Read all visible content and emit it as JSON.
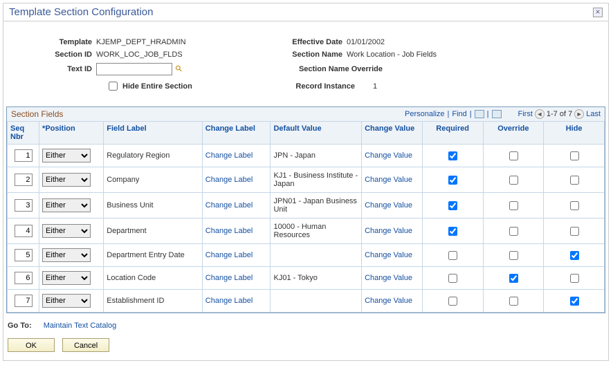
{
  "dialog": {
    "title": "Template Section Configuration"
  },
  "header": {
    "template_label": "Template",
    "template_value": "KJEMP_DEPT_HRADMIN",
    "eff_date_label": "Effective Date",
    "eff_date_value": "01/01/2002",
    "section_id_label": "Section ID",
    "section_id_value": "WORK_LOC_JOB_FLDS",
    "section_name_label": "Section Name",
    "section_name_value": "Work Location - Job Fields",
    "text_id_label": "Text ID",
    "text_id_value": "",
    "section_name_override_label": "Section Name Override",
    "section_name_override_value": "",
    "hide_section_label": "Hide Entire Section",
    "hide_section_checked": false,
    "record_instance_label": "Record Instance",
    "record_instance_value": "1"
  },
  "grid": {
    "title": "Section Fields",
    "personalize": "Personalize",
    "find": "Find",
    "pager_first": "First",
    "pager_text": "1-7 of 7",
    "pager_last": "Last",
    "columns": {
      "seq": "Seq Nbr",
      "position": "*Position",
      "field_label": "Field Label",
      "change_label": "Change Label",
      "default_value": "Default Value",
      "change_value": "Change Value",
      "required": "Required",
      "override": "Override",
      "hide": "Hide"
    },
    "rows": [
      {
        "seq": "1",
        "position": "Either",
        "field_label": "Regulatory Region",
        "change_label": "Change Label",
        "default_value": "JPN - Japan",
        "change_value": "Change Value",
        "required": true,
        "override": false,
        "hide": false
      },
      {
        "seq": "2",
        "position": "Either",
        "field_label": "Company",
        "change_label": "Change Label",
        "default_value": "KJ1 - Business Institute - Japan",
        "change_value": "Change Value",
        "required": true,
        "override": false,
        "hide": false
      },
      {
        "seq": "3",
        "position": "Either",
        "field_label": "Business Unit",
        "change_label": "Change Label",
        "default_value": "JPN01 - Japan Business Unit",
        "change_value": "Change Value",
        "required": true,
        "override": false,
        "hide": false
      },
      {
        "seq": "4",
        "position": "Either",
        "field_label": "Department",
        "change_label": "Change Label",
        "default_value": "10000 - Human Resources",
        "change_value": "Change Value",
        "required": true,
        "override": false,
        "hide": false
      },
      {
        "seq": "5",
        "position": "Either",
        "field_label": "Department Entry Date",
        "change_label": "Change Label",
        "default_value": "",
        "change_value": "Change Value",
        "required": false,
        "override": false,
        "hide": true
      },
      {
        "seq": "6",
        "position": "Either",
        "field_label": "Location Code",
        "change_label": "Change Label",
        "default_value": "KJ01 - Tokyo",
        "change_value": "Change Value",
        "required": false,
        "override": true,
        "hide": false
      },
      {
        "seq": "7",
        "position": "Either",
        "field_label": "Establishment ID",
        "change_label": "Change Label",
        "default_value": "",
        "change_value": "Change Value",
        "required": false,
        "override": false,
        "hide": true
      }
    ]
  },
  "goto": {
    "label": "Go To:",
    "link": "Maintain Text Catalog"
  },
  "buttons": {
    "ok": "OK",
    "cancel": "Cancel"
  }
}
